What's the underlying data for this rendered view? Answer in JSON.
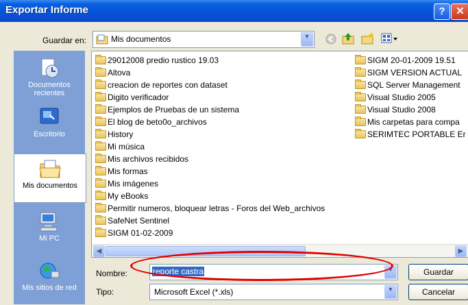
{
  "window": {
    "title": "Exportar Informe",
    "help_label": "?",
    "close_label": "✕"
  },
  "toolbar": {
    "save_in_label": "Guardar en:",
    "location_value": "Mis documentos",
    "icons": [
      "back-icon",
      "up-folder-icon",
      "new-folder-icon",
      "views-menu-icon"
    ]
  },
  "places": [
    {
      "label": "Documentos recientes",
      "icon": "recent-documents-icon"
    },
    {
      "label": "Escritorio",
      "icon": "desktop-icon"
    },
    {
      "label": "Mis documentos",
      "icon": "my-documents-icon",
      "selected": true
    },
    {
      "label": "Mi PC",
      "icon": "my-computer-icon"
    },
    {
      "label": "Mis sitios de red",
      "icon": "network-places-icon"
    }
  ],
  "files_col1": [
    "29012008 predio rustico 19.03",
    "Altova",
    "creacion de reportes con dataset",
    "Digito verificador",
    "Ejemplos de Pruebas de un sistema",
    "El blog de beto0o_archivos",
    "History",
    "Mi música",
    "Mis archivos recibidos",
    "Mis formas",
    "Mis imágenes",
    "My eBooks",
    "Permitir numeros, bloquear letras - Foros del Web_archivos",
    "SafeNet Sentinel",
    "SIGM 01-02-2009"
  ],
  "files_col2": [
    "SIGM 20-01-2009 19.51",
    "SIGM VERSION ACTUAL",
    "SQL Server Management",
    "Visual Studio 2005",
    "Visual Studio 2008",
    "Mis carpetas para compa",
    "SERIMTEC PORTABLE Er"
  ],
  "form": {
    "name_label": "Nombre:",
    "name_value": "reporte castra",
    "type_label": "Tipo:",
    "type_value": "Microsoft Excel (*.xls)"
  },
  "buttons": {
    "save": "Guardar",
    "cancel": "Cancelar"
  },
  "colors": {
    "title_bar": "#0553d8",
    "places_bar": "#7ea0d6",
    "highlight_oval": "#e00000",
    "selection": "#316ac5"
  }
}
